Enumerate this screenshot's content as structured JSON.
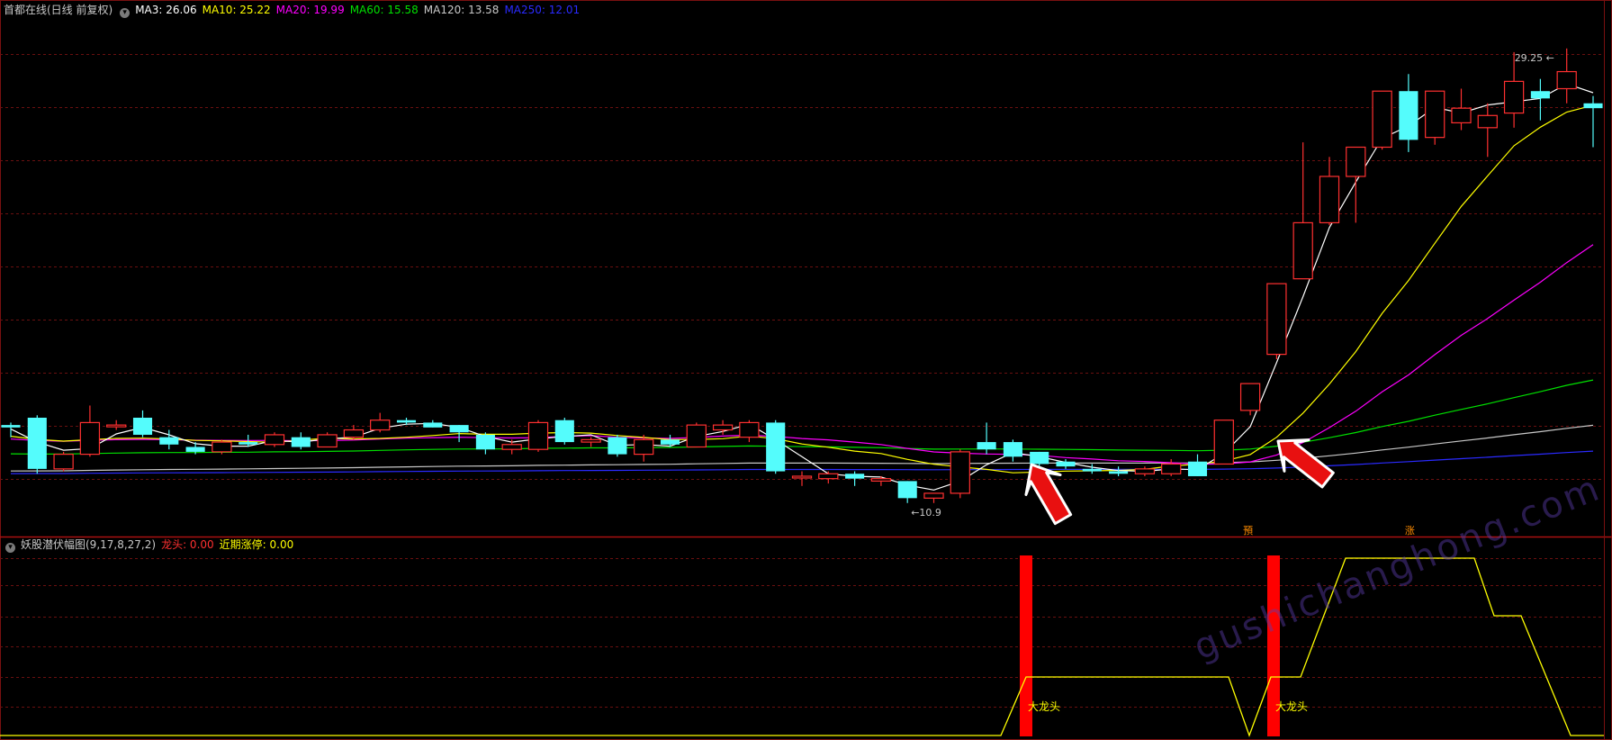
{
  "header_main": {
    "stock_name": "首都在线(日线 前复权)",
    "ma3": "MA3: 26.06",
    "ma10": "MA10: 25.22",
    "ma20": "MA20: 19.99",
    "ma60": "MA60: 15.58",
    "ma120": "MA120: 13.58",
    "ma250": "MA250: 12.01"
  },
  "header_sub": {
    "indicator": "妖股潜伏幅图(9,17,8,27,2)",
    "dragon_head": "龙头: 0.00",
    "recent_limit_up": "近期涨停: 0.00"
  },
  "annotations": {
    "high_label": "29.25",
    "low_label": "10.9",
    "signal_a": "預",
    "signal_b": "涨",
    "dragon_label_1": "大龙头",
    "dragon_label_2": "大龙头"
  },
  "watermark": "gushichanghong.com",
  "colors": {
    "up": "#ff3030",
    "down": "#54fcfc",
    "ma3": "#ffffff",
    "ma10": "#ffff00",
    "ma20": "#ff00ff",
    "ma60": "#00e000",
    "ma120": "#c8c8c8",
    "ma250": "#2a2aff"
  },
  "chart_data": [
    {
      "type": "candlestick",
      "price_range": [
        10.0,
        30.5
      ],
      "ohlc": [
        [
          13.8,
          13.9,
          13.3,
          13.7
        ],
        [
          14.1,
          14.2,
          11.8,
          12.0
        ],
        [
          12.0,
          12.7,
          11.9,
          12.6
        ],
        [
          12.6,
          14.6,
          12.5,
          13.9
        ],
        [
          13.8,
          14.0,
          13.6,
          13.8
        ],
        [
          14.1,
          14.4,
          13.3,
          13.4
        ],
        [
          13.3,
          13.6,
          12.8,
          13.0
        ],
        [
          12.9,
          13.1,
          12.6,
          12.7
        ],
        [
          12.7,
          13.2,
          12.6,
          13.1
        ],
        [
          13.1,
          13.4,
          12.9,
          13.0
        ],
        [
          13.0,
          13.5,
          12.9,
          13.4
        ],
        [
          13.3,
          13.5,
          12.8,
          12.9
        ],
        [
          12.9,
          13.5,
          12.9,
          13.4
        ],
        [
          13.3,
          13.8,
          13.2,
          13.6
        ],
        [
          13.6,
          14.3,
          13.5,
          14.0
        ],
        [
          14.0,
          14.1,
          13.8,
          13.9
        ],
        [
          13.9,
          14.0,
          13.7,
          13.7
        ],
        [
          13.8,
          13.8,
          13.1,
          13.5
        ],
        [
          13.4,
          13.5,
          12.6,
          12.8
        ],
        [
          12.8,
          13.2,
          12.6,
          13.0
        ],
        [
          12.8,
          14.0,
          12.7,
          13.9
        ],
        [
          14.0,
          14.1,
          13.0,
          13.1
        ],
        [
          13.1,
          13.3,
          12.9,
          13.2
        ],
        [
          13.3,
          13.4,
          12.5,
          12.6
        ],
        [
          12.6,
          13.4,
          12.3,
          13.2
        ],
        [
          13.2,
          13.4,
          12.9,
          13.0
        ],
        [
          12.9,
          13.9,
          12.9,
          13.8
        ],
        [
          13.6,
          14.0,
          13.4,
          13.8
        ],
        [
          13.3,
          14.0,
          13.1,
          13.9
        ],
        [
          13.9,
          14.0,
          11.8,
          11.9
        ],
        [
          11.7,
          11.9,
          11.3,
          11.7
        ],
        [
          11.6,
          11.9,
          11.4,
          11.8
        ],
        [
          11.8,
          11.9,
          11.3,
          11.6
        ],
        [
          11.5,
          11.7,
          11.3,
          11.6
        ],
        [
          11.5,
          11.5,
          10.6,
          10.8
        ],
        [
          10.8,
          11.0,
          10.6,
          11.0
        ],
        [
          11.0,
          12.8,
          10.8,
          12.7
        ],
        [
          13.1,
          13.9,
          12.6,
          12.8
        ],
        [
          13.1,
          13.2,
          12.3,
          12.5
        ],
        [
          12.7,
          12.7,
          12.1,
          12.2
        ],
        [
          12.3,
          12.4,
          12.0,
          12.1
        ],
        [
          12.0,
          12.2,
          11.8,
          11.9
        ],
        [
          11.9,
          12.1,
          11.7,
          11.8
        ],
        [
          11.8,
          12.1,
          11.7,
          12.0
        ],
        [
          11.8,
          12.4,
          11.7,
          12.2
        ],
        [
          12.3,
          12.6,
          11.7,
          11.7
        ],
        [
          12.2,
          14.0,
          12.2,
          14.0
        ],
        [
          14.4,
          15.0,
          14.2,
          15.5
        ],
        [
          16.7,
          18.1,
          16.5,
          19.6
        ],
        [
          19.8,
          25.4,
          19.8,
          22.1
        ],
        [
          22.1,
          24.8,
          22.0,
          24.0
        ],
        [
          24.0,
          25.2,
          22.1,
          25.2
        ],
        [
          25.2,
          27.1,
          25.1,
          27.5
        ],
        [
          27.5,
          28.2,
          25.0,
          25.5
        ],
        [
          25.6,
          27.5,
          25.3,
          27.5
        ],
        [
          26.2,
          27.6,
          25.9,
          26.8
        ],
        [
          26.0,
          27.0,
          24.8,
          26.5
        ],
        [
          26.6,
          29.1,
          26.0,
          27.9
        ],
        [
          27.5,
          28.0,
          26.3,
          27.2
        ],
        [
          27.6,
          29.25,
          27.0,
          28.3
        ],
        [
          27.0,
          27.3,
          25.2,
          26.8
        ]
      ],
      "moving_averages": {
        "MA3": "26.06",
        "MA10": "25.22",
        "MA20": "19.99",
        "MA60": "15.58",
        "MA120": "13.58",
        "MA250": "12.01"
      },
      "annotations": [
        {
          "type": "max",
          "value": 29.25,
          "label": "29.25"
        },
        {
          "type": "min",
          "value": 10.9,
          "label": "10.9"
        }
      ]
    },
    {
      "type": "indicator",
      "name": "妖股潜伏幅图(9,17,8,27,2)",
      "series": [
        {
          "name": "龙头",
          "value": 0.0
        },
        {
          "name": "近期涨停",
          "value": 0.0
        }
      ],
      "signal_bars": [
        {
          "label": "大龙头"
        },
        {
          "label": "大龙头"
        }
      ]
    }
  ]
}
